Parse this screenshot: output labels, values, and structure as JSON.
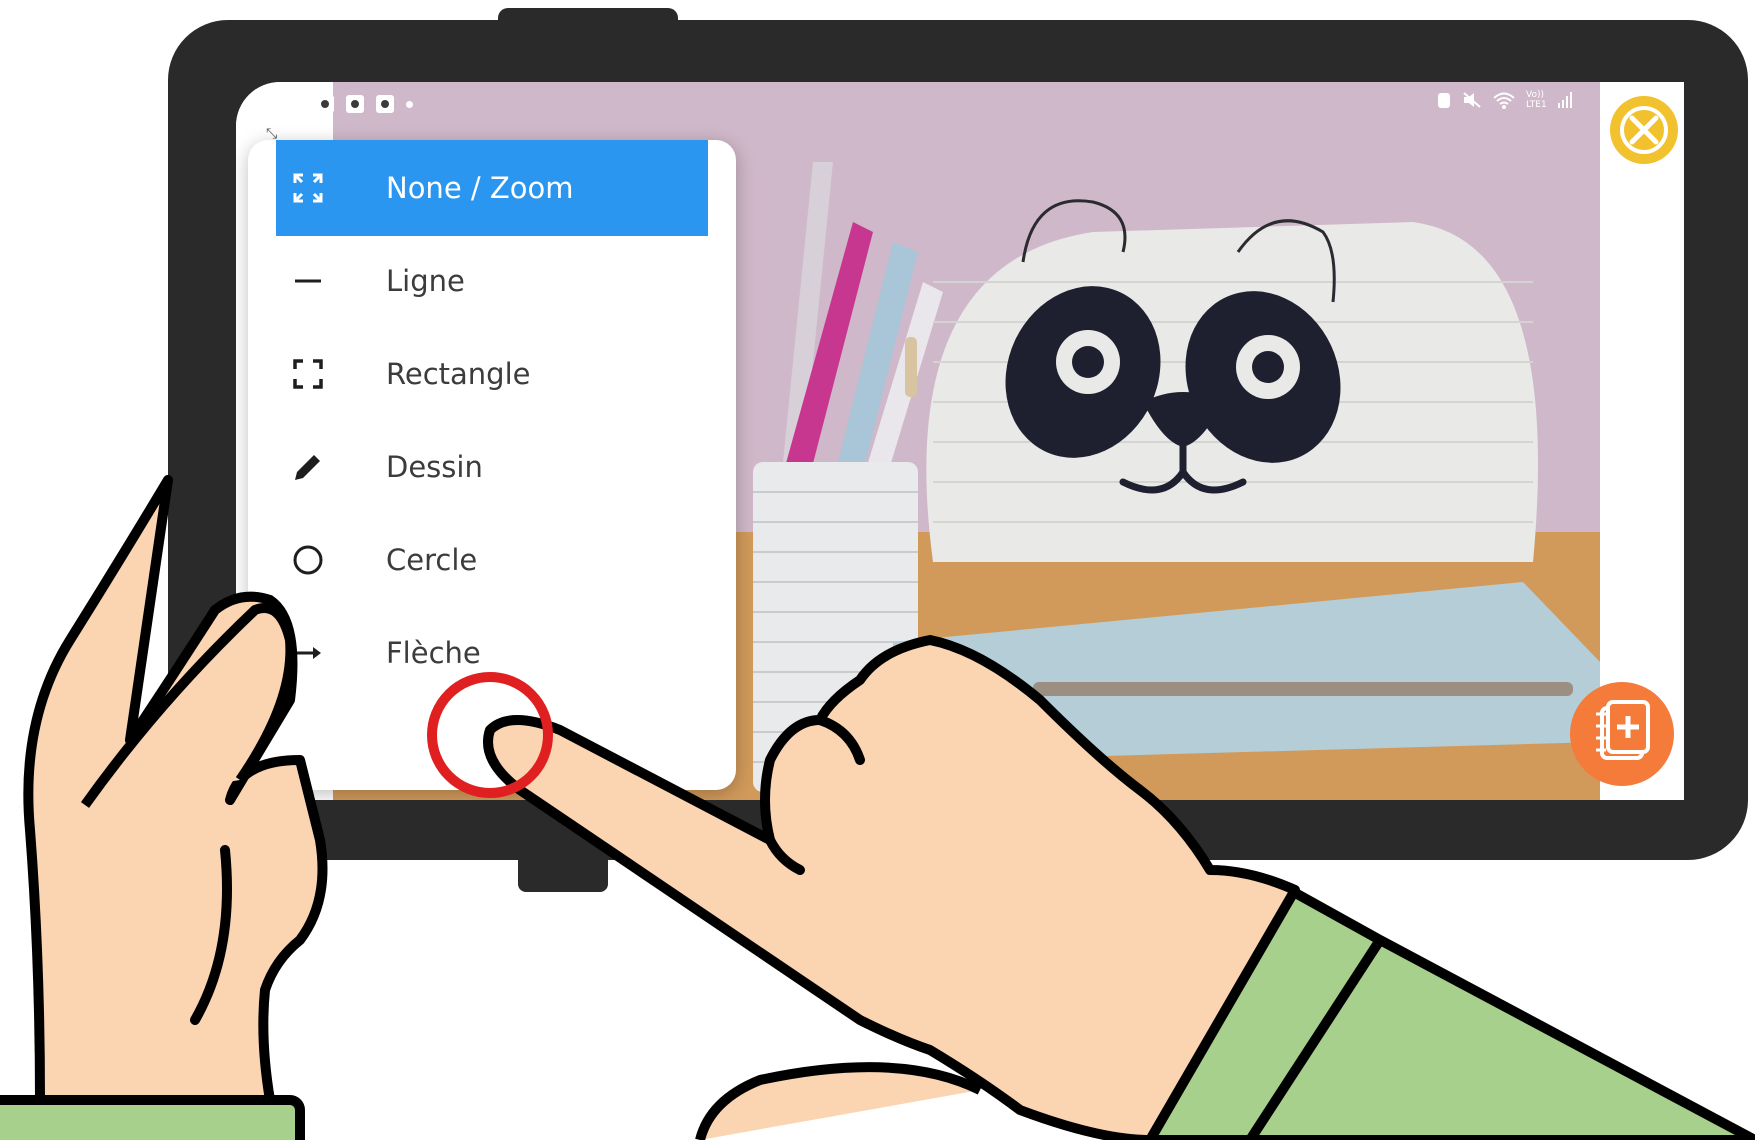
{
  "tool_menu": {
    "items": [
      {
        "label": "None / Zoom",
        "icon": "zoom-expand-icon",
        "active": true
      },
      {
        "label": "Ligne",
        "icon": "line-icon",
        "active": false
      },
      {
        "label": "Rectangle",
        "icon": "rectangle-icon",
        "active": false
      },
      {
        "label": "Dessin",
        "icon": "pencil-icon",
        "active": false
      },
      {
        "label": "Cercle",
        "icon": "circle-icon",
        "active": false
      },
      {
        "label": "Flèche",
        "icon": "arrow-right-icon",
        "active": false
      }
    ]
  },
  "status_bar": {
    "network_label_top": "Vo))",
    "network_label_bottom": "LTE1"
  },
  "buttons": {
    "close_icon": "close-x-icon",
    "add_note_icon": "add-note-icon"
  },
  "colors": {
    "active_item": "#2b96f0",
    "close_button": "#f2c12e",
    "note_button": "#f47b3a",
    "tap_highlight": "#e02020",
    "skin": "#fbd4b2",
    "sleeve": "#a8d08d"
  }
}
